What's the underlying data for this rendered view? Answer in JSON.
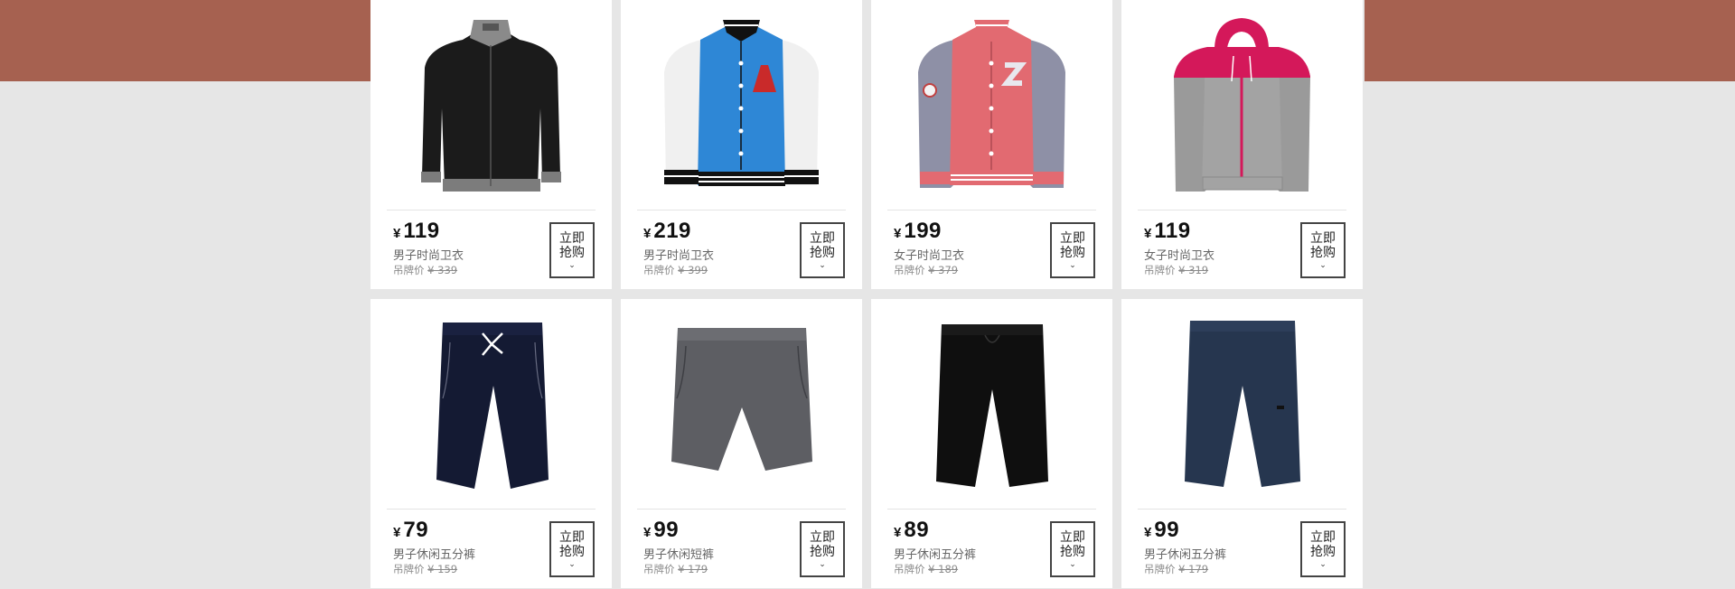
{
  "products": [
    {
      "currency": "¥",
      "price": "119",
      "name": "男子时尚卫衣",
      "tag_label": "吊牌价",
      "tag_price": "¥ 339",
      "buy_label_1": "立即",
      "buy_label_2": "抢购",
      "chevron": "⌄",
      "image": "black-track-jacket-image"
    },
    {
      "currency": "¥",
      "price": "219",
      "name": "男子时尚卫衣",
      "tag_label": "吊牌价",
      "tag_price": "¥ 399",
      "buy_label_1": "立即",
      "buy_label_2": "抢购",
      "chevron": "⌄",
      "image": "blue-varsity-jacket-image"
    },
    {
      "currency": "¥",
      "price": "199",
      "name": "女子时尚卫衣",
      "tag_label": "吊牌价",
      "tag_price": "¥ 379",
      "buy_label_1": "立即",
      "buy_label_2": "抢购",
      "chevron": "⌄",
      "image": "pink-varsity-jacket-image"
    },
    {
      "currency": "¥",
      "price": "119",
      "name": "女子时尚卫衣",
      "tag_label": "吊牌价",
      "tag_price": "¥ 319",
      "buy_label_1": "立即",
      "buy_label_2": "抢购",
      "chevron": "⌄",
      "image": "grey-pink-hoodie-image"
    },
    {
      "currency": "¥",
      "price": "79",
      "name": "男子休闲五分裤",
      "tag_label": "吊牌价",
      "tag_price": "¥ 159",
      "buy_label_1": "立即",
      "buy_label_2": "抢购",
      "chevron": "⌄",
      "image": "navy-shorts-image"
    },
    {
      "currency": "¥",
      "price": "99",
      "name": "男子休闲短裤",
      "tag_label": "吊牌价",
      "tag_price": "¥ 179",
      "buy_label_1": "立即",
      "buy_label_2": "抢购",
      "chevron": "⌄",
      "image": "grey-shorts-image"
    },
    {
      "currency": "¥",
      "price": "89",
      "name": "男子休闲五分裤",
      "tag_label": "吊牌价",
      "tag_price": "¥ 189",
      "buy_label_1": "立即",
      "buy_label_2": "抢购",
      "chevron": "⌄",
      "image": "black-shorts-image"
    },
    {
      "currency": "¥",
      "price": "99",
      "name": "男子休闲五分裤",
      "tag_label": "吊牌价",
      "tag_price": "¥ 179",
      "buy_label_1": "立即",
      "buy_label_2": "抢购",
      "chevron": "⌄",
      "image": "dark-blue-shorts-image"
    }
  ],
  "colors": {
    "banner": "#a66150",
    "page_background": "#e6e6e6",
    "card_background": "#ffffff"
  }
}
